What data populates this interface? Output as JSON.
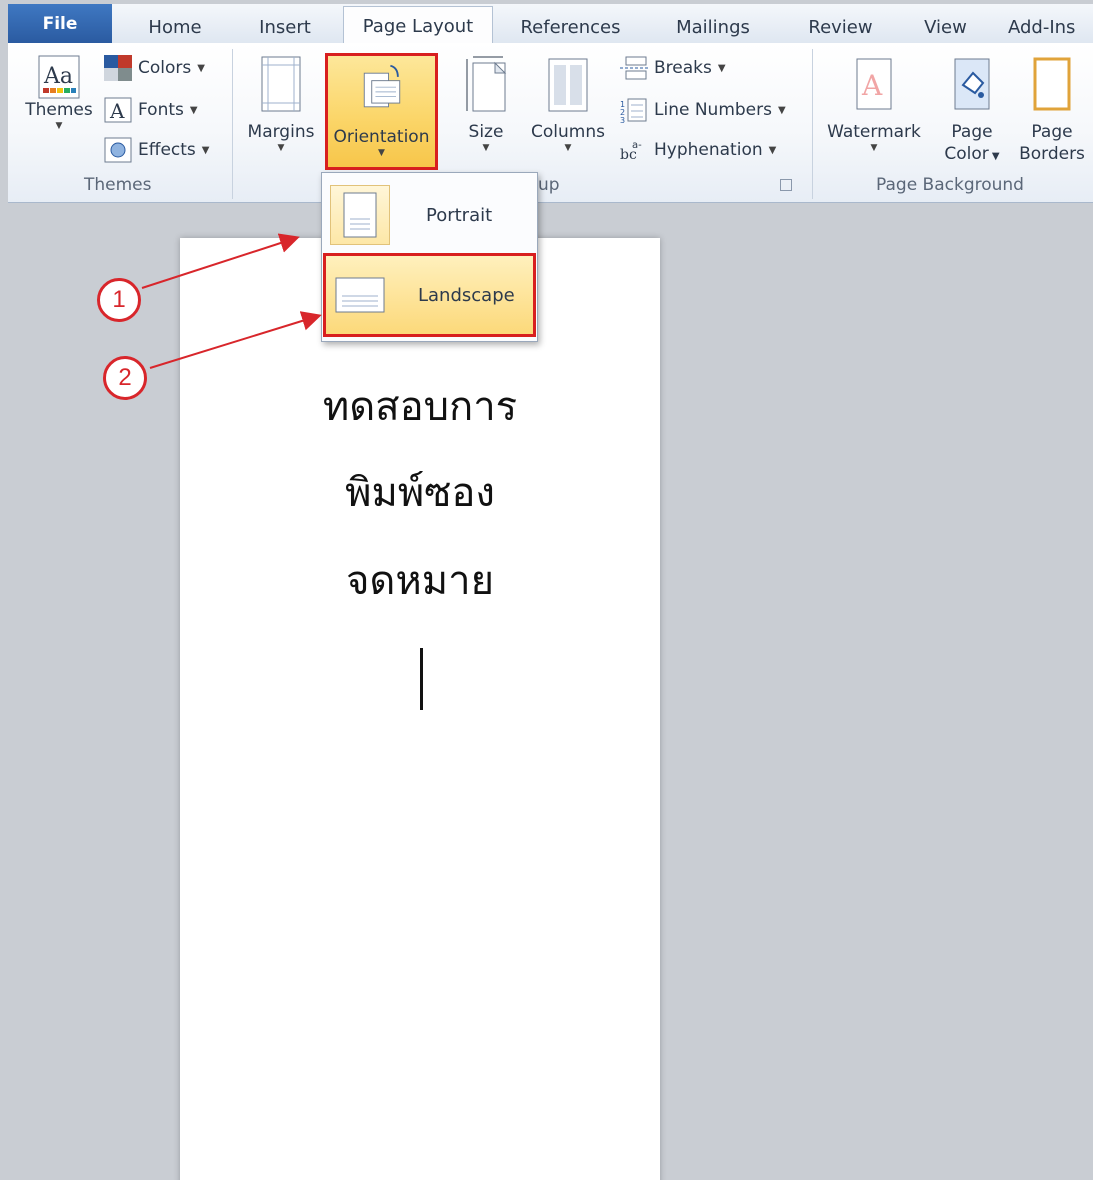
{
  "tabs": [
    {
      "label": "File"
    },
    {
      "label": "Home"
    },
    {
      "label": "Insert"
    },
    {
      "label": "Page Layout"
    },
    {
      "label": "References"
    },
    {
      "label": "Mailings"
    },
    {
      "label": "Review"
    },
    {
      "label": "View"
    },
    {
      "label": "Add-Ins"
    }
  ],
  "ribbon": {
    "themes_group": {
      "themes_button": "Themes",
      "colors": "Colors",
      "fonts": "Fonts",
      "effects": "Effects",
      "label": "Themes"
    },
    "page_setup_group": {
      "margins": "Margins",
      "orientation": "Orientation",
      "size": "Size",
      "columns": "Columns",
      "breaks": "Breaks",
      "line_numbers": "Line Numbers",
      "hyphenation": "Hyphenation",
      "label_fragment": "up"
    },
    "page_background_group": {
      "watermark": "Watermark",
      "page_color_line1": "Page",
      "page_color_line2": "Color",
      "page_borders_line1": "Page",
      "page_borders_line2": "Borders",
      "label": "Page Background"
    }
  },
  "orientation_menu": {
    "portrait": "Portrait",
    "landscape": "Landscape"
  },
  "document": {
    "lines": [
      "ทดสอบการ",
      "พิมพ์ซอง",
      "จดหมาย"
    ]
  },
  "callouts": {
    "step1": "1",
    "step2": "2"
  },
  "colors": {
    "highlight_border": "#d81f1f",
    "file_tab": "#2a5aa0",
    "hover_gold": "#fbd66a"
  }
}
